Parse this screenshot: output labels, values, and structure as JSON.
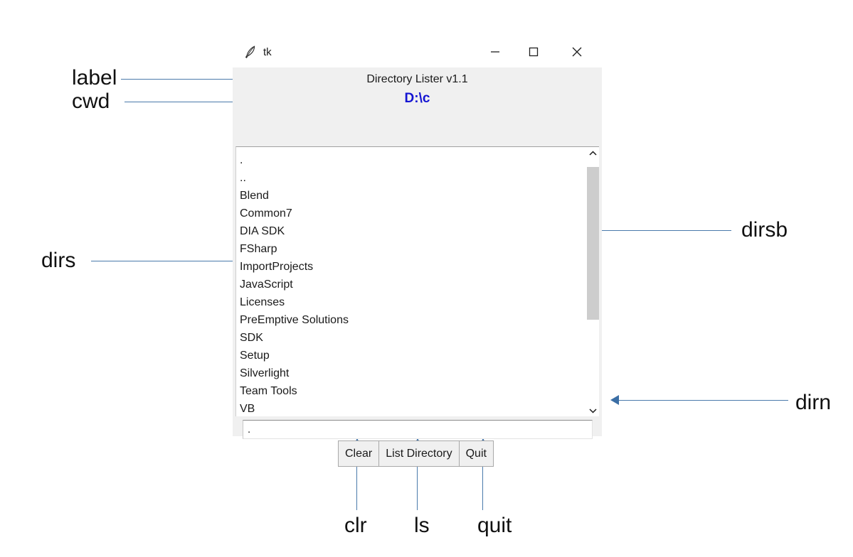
{
  "window": {
    "title": "tk",
    "icon": "tk-feather-icon",
    "controls": {
      "minimize": "minimize-icon",
      "maximize": "maximize-icon",
      "close": "close-icon"
    }
  },
  "app": {
    "heading": "Directory Lister v1.1",
    "cwd": "D:\\c",
    "cwd_color": "#1414d2",
    "directories": [
      ".",
      "..",
      "Blend",
      "Common7",
      "DIA SDK",
      "FSharp",
      "ImportProjects",
      "JavaScript",
      "Licenses",
      "PreEmptive Solutions",
      "SDK",
      "Setup",
      "Silverlight",
      "Team Tools",
      "VB"
    ],
    "entry_value": ".",
    "entry_placeholder": "",
    "buttons": [
      {
        "label": "Clear"
      },
      {
        "label": "List Directory"
      },
      {
        "label": "Quit"
      }
    ],
    "scrollbar": {
      "up_arrow": "chevron-up-icon",
      "down_arrow": "chevron-down-icon"
    }
  },
  "annotations": {
    "arrow_color": "#3b6ea5",
    "label": "label",
    "cwd": "cwd",
    "dirs": "dirs",
    "dirsb": "dirsb",
    "dirn": "dirn",
    "clr": "clr",
    "ls": "ls",
    "quit": "quit"
  }
}
